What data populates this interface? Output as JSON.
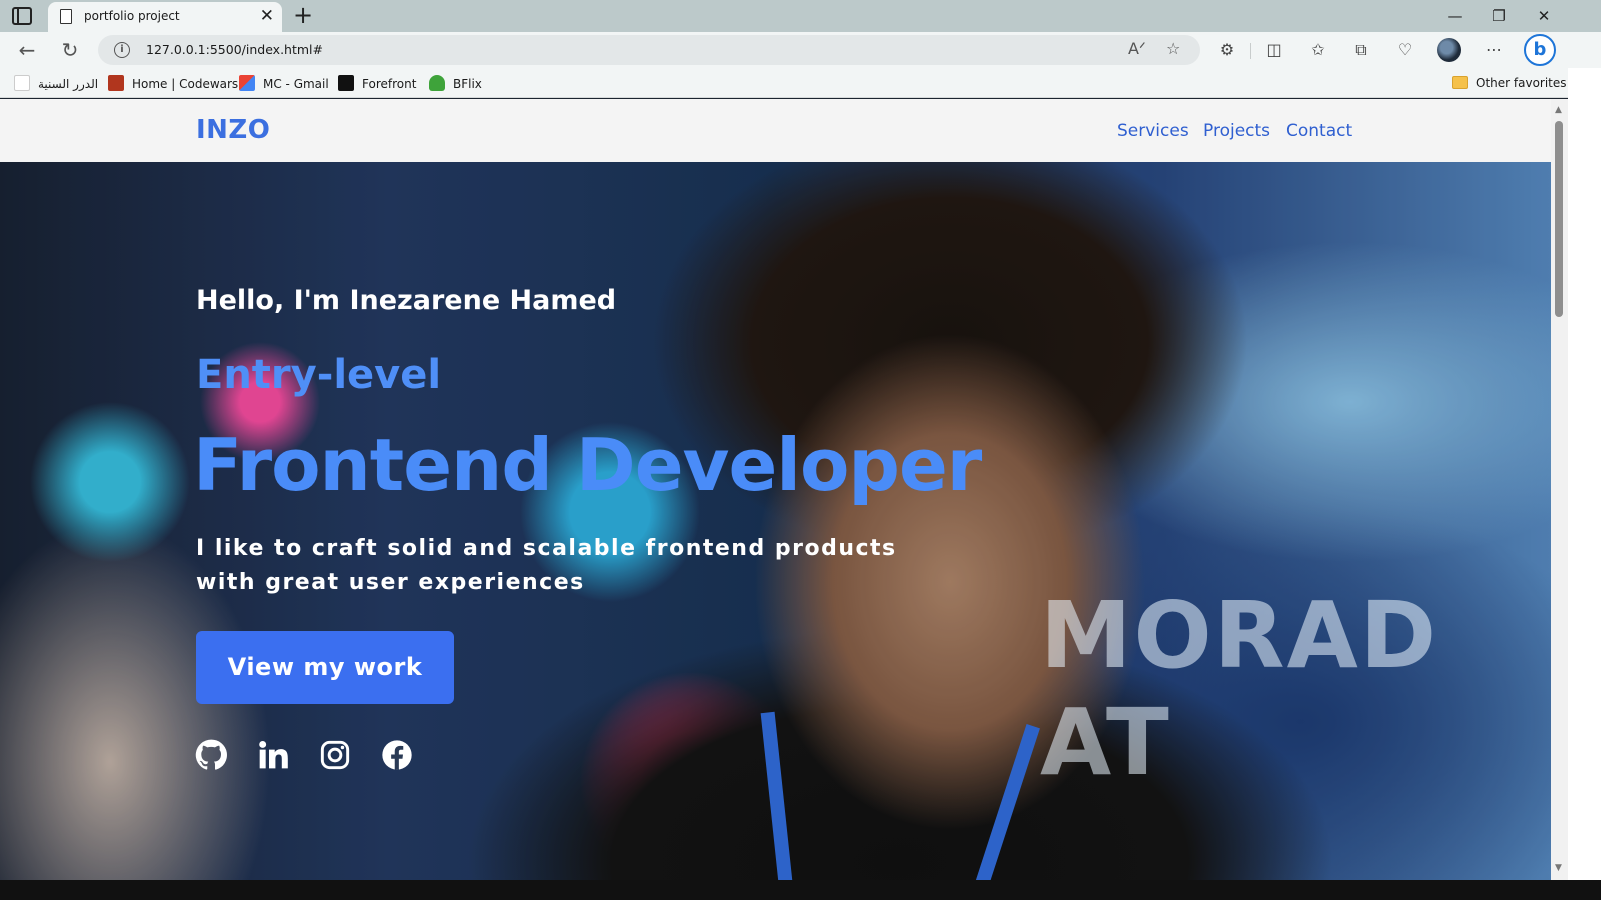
{
  "browser": {
    "tab_title": "portfolio project",
    "url": "127.0.0.1:5500/index.html#",
    "bookmarks": [
      {
        "label": "الدرر السنية"
      },
      {
        "label": "Home | Codewars"
      },
      {
        "label": "MC - Gmail"
      },
      {
        "label": "Forefront"
      },
      {
        "label": "BFlix"
      }
    ],
    "other_favorites": "Other favorites"
  },
  "site": {
    "logo": "INZO",
    "nav": [
      "Services",
      "Projects",
      "Contact"
    ],
    "hero": {
      "greeting": "Hello, I'm Inezarene Hamed",
      "level": "Entry-level",
      "role": "Frontend Developer",
      "tagline_line1": "I like to craft solid and scalable frontend products",
      "tagline_line2": "with great user experiences",
      "cta": "View my work",
      "socials": [
        "github-icon",
        "linkedin-icon",
        "instagram-icon",
        "facebook-icon"
      ],
      "background_text": "MORAD AT"
    }
  },
  "colors": {
    "accent": "#3b6ff0",
    "heading_blue": "#4a8cf8",
    "logo_blue": "#3b6fe0"
  }
}
